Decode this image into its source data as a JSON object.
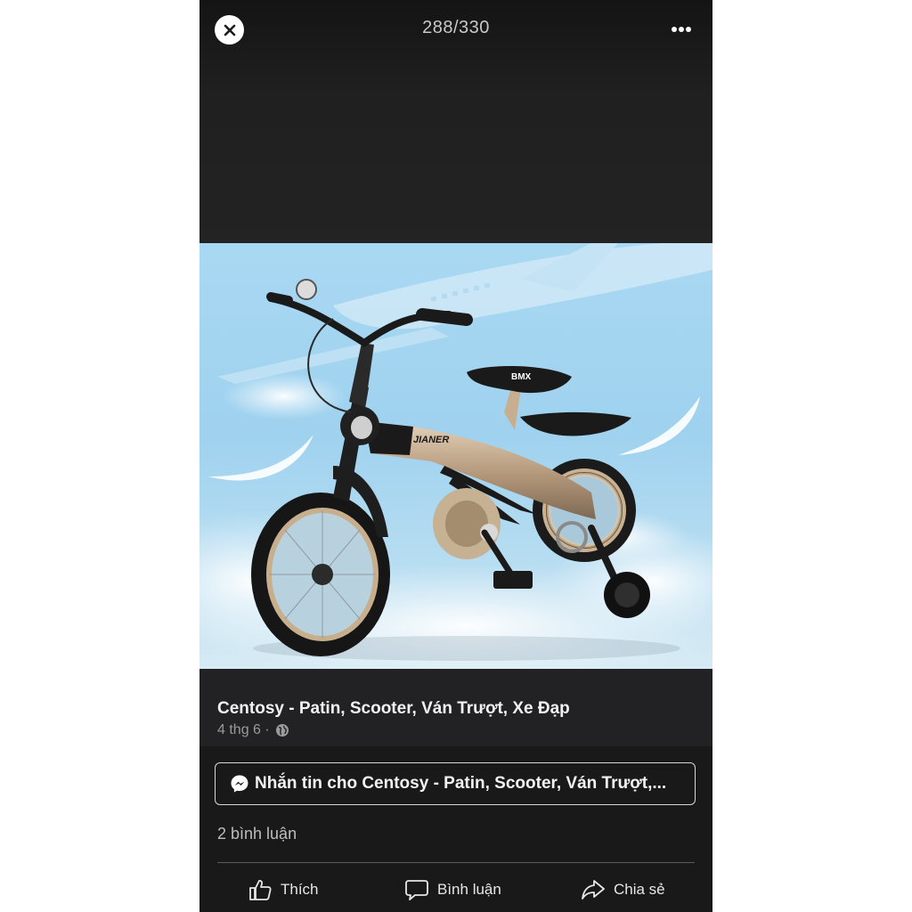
{
  "viewer": {
    "counter": "288/330",
    "close_icon": "close-icon",
    "more_icon": "more-horizontal-icon"
  },
  "photo": {
    "frame_brand": "JIANER",
    "seat_brand": "BMX"
  },
  "post": {
    "page_name": "Centosy - Patin, Scooter, Ván Trượt, Xe Đạp",
    "date": "4 thg 6 ·",
    "privacy_icon": "globe-icon"
  },
  "message_button": {
    "icon": "messenger-icon",
    "label": "Nhắn tin cho Centosy - Patin, Scooter, Ván Trượt,..."
  },
  "comments_count": "2 bình luận",
  "actions": {
    "like": "Thích",
    "comment": "Bình luận",
    "share": "Chia sẻ"
  },
  "colors": {
    "background": "#1c1c1e",
    "sky": "#a9d8f2",
    "frame": "#b49a7a"
  }
}
